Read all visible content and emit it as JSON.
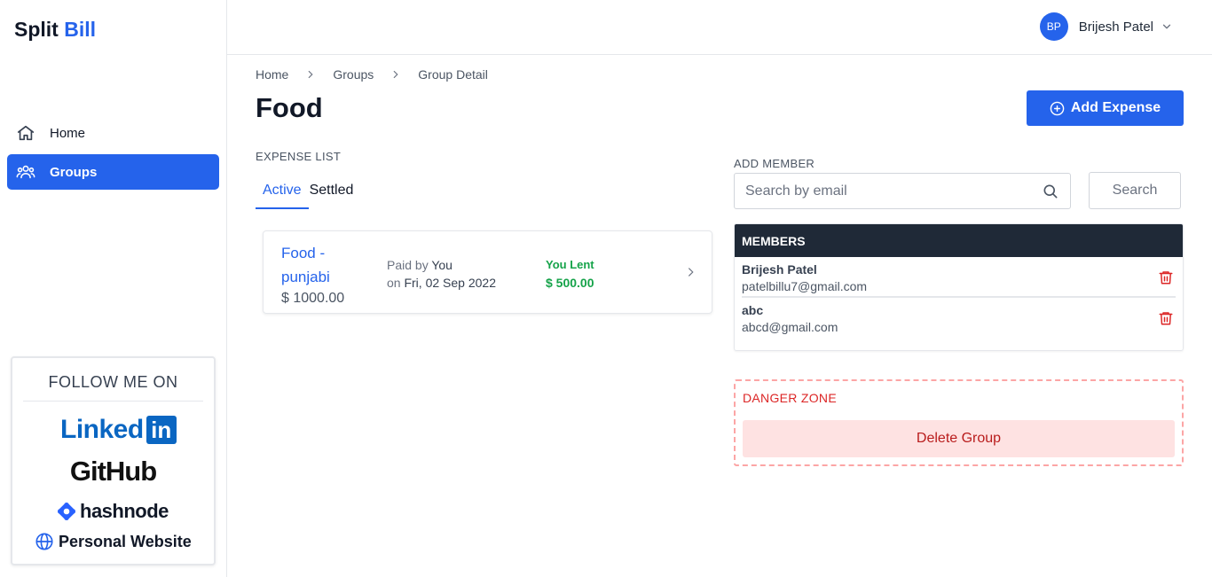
{
  "app": {
    "logo_main": "Split",
    "logo_accent": "Bill"
  },
  "sidebar": {
    "items": [
      {
        "label": "Home",
        "icon": "home-icon",
        "active": false
      },
      {
        "label": "Groups",
        "icon": "users-icon",
        "active": true
      }
    ]
  },
  "follow": {
    "title": "FOLLOW ME ON",
    "linkedin": "Linked",
    "linkedin_box": "in",
    "github": "GitHub",
    "hashnode": "hashnode",
    "website": "Personal Website"
  },
  "header": {
    "user_initials": "BP",
    "user_name": "Brijesh Patel"
  },
  "breadcrumb": [
    "Home",
    "Groups",
    "Group Detail"
  ],
  "group": {
    "title": "Food",
    "add_expense_label": "Add Expense"
  },
  "expenses": {
    "section_label": "EXPENSE LIST",
    "tabs": [
      {
        "label": "Active",
        "active": true
      },
      {
        "label": "Settled",
        "active": false
      }
    ],
    "items": [
      {
        "name": "Food - punjabi",
        "amount": "$ 1000.00",
        "paid_prefix": "Paid by",
        "paid_by": "You",
        "date_prefix": "on",
        "date": "Fri, 02 Sep 2022",
        "status": "You Lent",
        "status_amount": "$ 500.00"
      }
    ]
  },
  "add_member": {
    "section_label": "ADD MEMBER",
    "placeholder": "Search by email",
    "search_label": "Search"
  },
  "members": {
    "title": "MEMBERS",
    "items": [
      {
        "name": "Brijesh Patel",
        "email": "patelbillu7@gmail.com"
      },
      {
        "name": "abc",
        "email": "abcd@gmail.com"
      }
    ]
  },
  "danger_zone": {
    "title": "DANGER ZONE",
    "delete_label": "Delete Group"
  },
  "colors": {
    "primary": "#2563eb",
    "success": "#16a34a",
    "danger": "#dc2626",
    "dark": "#1f2937"
  }
}
